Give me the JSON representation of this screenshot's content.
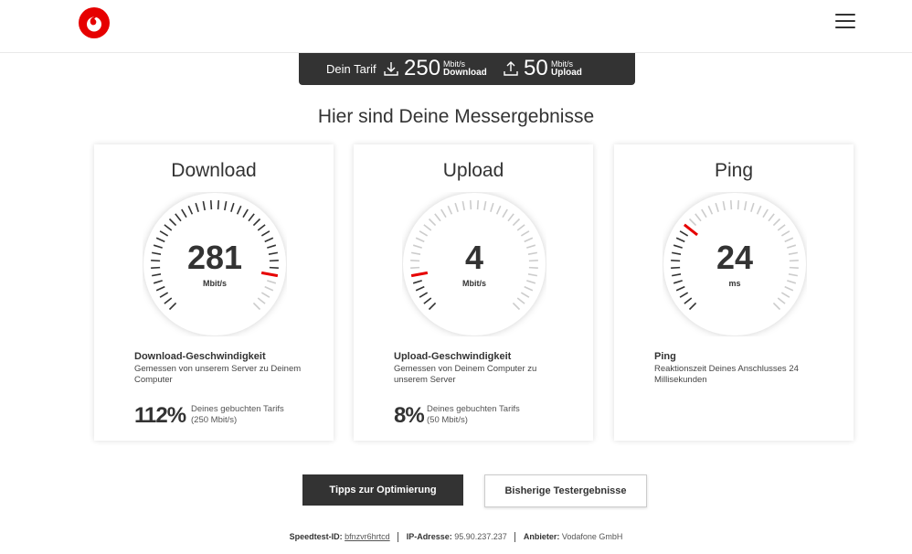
{
  "header": {
    "logo_icon": "vodafone-logo",
    "menu_icon": "hamburger-menu-icon",
    "brand_color": "#e60000"
  },
  "tarif": {
    "label": "Dein Tarif",
    "download_value": "250",
    "download_unit": "Mbit/s",
    "download_label": "Download",
    "upload_value": "50",
    "upload_unit": "Mbit/s",
    "upload_label": "Upload"
  },
  "headline": "Hier sind Deine Messergebnisse",
  "cards": [
    {
      "title": "Download",
      "value": "281",
      "unit": "Mbit/s",
      "gauge_fraction": 0.87,
      "sub_title": "Download-Geschwindigkeit",
      "description": "Gemessen von unserem Server zu Deinem Computer",
      "percent": "112%",
      "percent_text_1": "Deines gebuchten Tarifs",
      "percent_text_2": "(250 Mbit/s)"
    },
    {
      "title": "Upload",
      "value": "4",
      "unit": "Mbit/s",
      "gauge_fraction": 0.13,
      "sub_title": "Upload-Geschwindigkeit",
      "description": "Gemessen von Deinem Computer zu unserem Server",
      "percent": "8%",
      "percent_text_1": "Deines gebuchten Tarifs",
      "percent_text_2": "(50 Mbit/s)"
    },
    {
      "title": "Ping",
      "value": "24",
      "unit": "ms",
      "gauge_fraction": 0.3,
      "sub_title": "Ping",
      "description": "Reaktionszeit Deines Anschlusses 24 Millisekunden",
      "percent": "",
      "percent_text_1": "",
      "percent_text_2": ""
    }
  ],
  "buttons": {
    "optimize": "Tipps zur Optimierung",
    "history": "Bisherige Testergebnisse"
  },
  "footer": {
    "speedtest_label": "Speedtest-ID:",
    "speedtest_id": "bfnzvr6hrtcd",
    "ip_label": "IP-Adresse:",
    "ip_value": "95.90.237.237",
    "provider_label": "Anbieter:",
    "provider_value": "Vodafone GmbH"
  },
  "colors": {
    "gauge_tick": "#333333",
    "gauge_tick_muted": "#cccccc",
    "gauge_marker": "#e60000"
  }
}
